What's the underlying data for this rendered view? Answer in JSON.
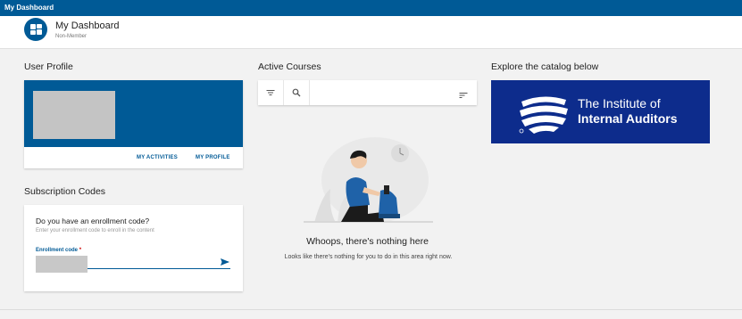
{
  "window": {
    "title": "My Dashboard"
  },
  "header": {
    "title": "My Dashboard",
    "subtitle": "Non-Member"
  },
  "profile": {
    "section_title": "User Profile",
    "links": [
      "MY ACTIVITIES",
      "MY PROFILE"
    ]
  },
  "subscription": {
    "section_title": "Subscription Codes",
    "question": "Do you have an enrollment code?",
    "hint": "Enter your enrollment code to enroll in the content",
    "field_label": "Enrollment code",
    "required_mark": "*"
  },
  "courses": {
    "section_title": "Active Courses",
    "empty_title": "Whoops, there's nothing here",
    "empty_text": "Looks like there's nothing for you to do in this area right now."
  },
  "catalog": {
    "section_title": "Explore the catalog below",
    "banner_line1": "The Institute of",
    "banner_line2": "Internal Auditors"
  },
  "icons": [
    "dashboard-icon",
    "filter-icon",
    "search-icon",
    "sort-icon",
    "send-icon",
    "iia-globe-icon"
  ],
  "colors": {
    "brand": "#005a96",
    "iia": "#0d2c8c",
    "background": "#f2f2f2"
  }
}
